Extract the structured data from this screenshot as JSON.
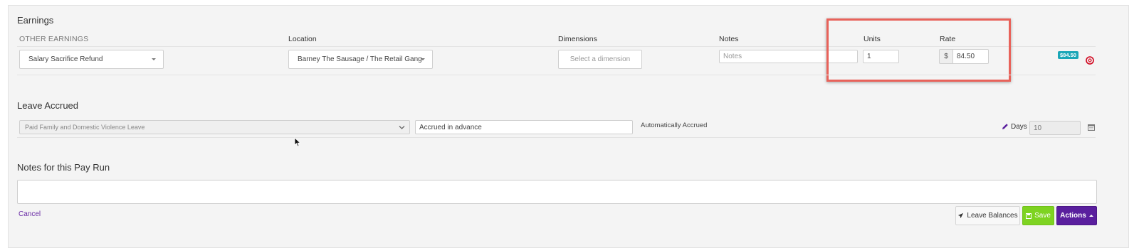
{
  "earnings": {
    "title": "Earnings",
    "columns": {
      "other_earnings": "OTHER EARNINGS",
      "location": "Location",
      "dimensions": "Dimensions",
      "notes": "Notes",
      "units": "Units",
      "rate": "Rate"
    },
    "row": {
      "earning_type": "Salary Sacrifice Refund",
      "location": "Barney The Sausage / The Retail Gang",
      "dimension_placeholder": "Select a dimension",
      "notes_placeholder": "Notes",
      "units": "1",
      "currency_symbol": "$",
      "rate": "84.50",
      "total_badge": "$84.50"
    }
  },
  "leave": {
    "title": "Leave Accrued",
    "leave_type": "Paid Family and Domestic Violence Leave",
    "accrual_method": "Accrued in advance",
    "status_text": "Automatically Accrued",
    "days_label": "Days",
    "days_value": "10"
  },
  "notes": {
    "title": "Notes for this Pay Run",
    "value": ""
  },
  "footer": {
    "cancel_label": "Cancel",
    "leave_balances_label": "Leave Balances",
    "save_label": "Save",
    "actions_label": "Actions"
  },
  "colors": {
    "highlight": "#e8625a",
    "badge": "#1aa6b7",
    "save": "#7ed321",
    "actions": "#5a1f9e",
    "remove": "#d0021b"
  },
  "icons": {
    "remove": "remove-circle-icon",
    "edit": "pencil-icon",
    "calendar": "calendar-icon",
    "leave_balances": "plane-icon",
    "save": "floppy-disk-icon",
    "actions": "caret-up-icon"
  }
}
